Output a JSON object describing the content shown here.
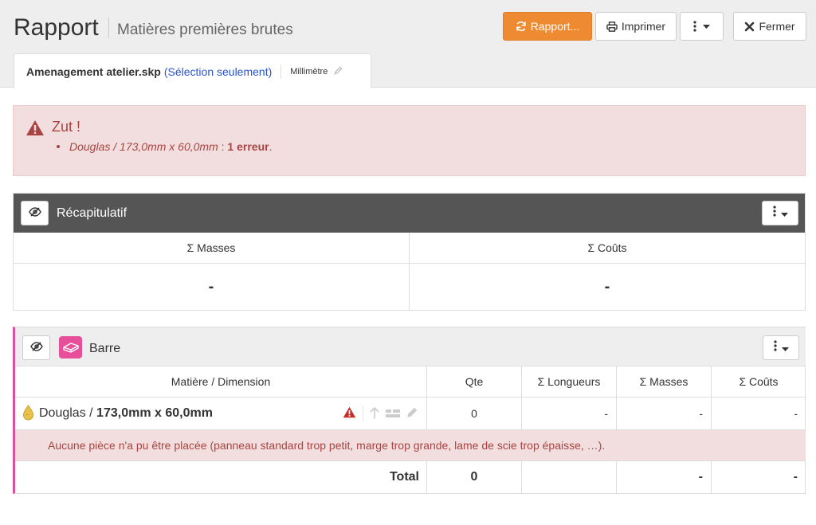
{
  "header": {
    "title": "Rapport",
    "subtitle": "Matières premières brutes",
    "rapport_label": "Rapport...",
    "print_label": "Imprimer",
    "close_label": "Fermer"
  },
  "tab": {
    "file": "Amenagement atelier.skp",
    "selection": "(Sélection seulement)",
    "unit": "Millimètre"
  },
  "alert": {
    "title": "Zut !",
    "item": "Douglas / 173,0mm x 60,0mm",
    "separator": " : ",
    "count": "1 erreur",
    "suffix": "."
  },
  "summary": {
    "title": "Récapitulatif",
    "col_masses": "Σ Masses",
    "col_couts": "Σ Coûts",
    "val_masses": "-",
    "val_couts": "-"
  },
  "barre": {
    "title": "Barre",
    "columns": [
      "Matière / Dimension",
      "Qte",
      "Σ Longueurs",
      "Σ Masses",
      "Σ Coûts"
    ],
    "row": {
      "material": "Douglas",
      "dims_sep": " / ",
      "dims": "173,0mm x 60,0mm",
      "qty": "0",
      "longueurs": "-",
      "masses": "-",
      "couts": "-"
    },
    "error": "Aucune pièce n'a pu être placée (panneau standard trop petit, marge trop grande, lame de scie trop épaisse, …).",
    "total": {
      "label": "Total",
      "qty": "0",
      "longueurs": "",
      "masses": "-",
      "couts": "-"
    }
  },
  "colors": {
    "accent_orange": "#ee8a31",
    "danger": "#a94442",
    "barre_pink": "#e84f9a",
    "summary_header": "#555555"
  },
  "icons": {
    "rapport": "refresh-icon",
    "print": "printer-icon",
    "more": "vertical-ellipsis-icon",
    "close": "x-icon",
    "warning": "warning-triangle-icon",
    "visibility": "eye-slash-icon",
    "material": "wood-drop-icon",
    "type": "bar-profile-icon"
  }
}
